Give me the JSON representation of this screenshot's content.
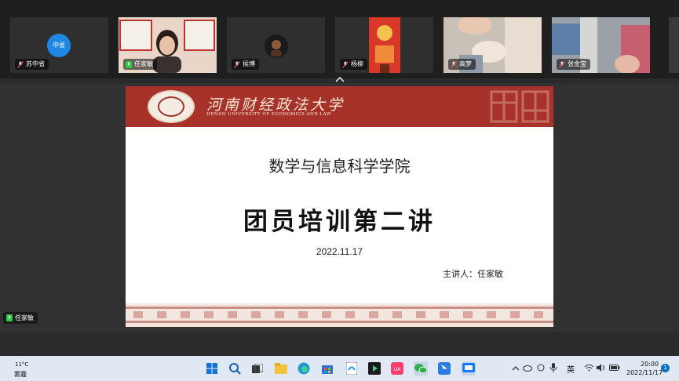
{
  "participants": [
    {
      "name": "苏中省",
      "avatar_text": "中省",
      "mic": "muted"
    },
    {
      "name": "任家敏",
      "mic": "active"
    },
    {
      "name": "侯博",
      "mic": "muted"
    },
    {
      "name": "杨柳",
      "mic": "muted"
    },
    {
      "name": "高梦",
      "mic": "muted"
    },
    {
      "name": "张金宝",
      "mic": "muted"
    }
  ],
  "slide": {
    "university_cn": "河南财经政法大学",
    "university_en": "HENAN UNIVERSITY OF ECONOMICS AND LAW",
    "college": "数学与信息科学学院",
    "lecture_title": "团员培训第二讲",
    "date": "2022.11.17",
    "speaker": "主讲人：任家敏"
  },
  "self_view": {
    "name": "任家敏"
  },
  "taskbar": {
    "weather": {
      "temp": "11°C",
      "desc": "雾霾"
    },
    "icons": [
      "windows-start-icon",
      "search-icon",
      "task-view-icon",
      "file-explorer-icon",
      "edge-browser-icon",
      "store-icon",
      "notepad-icon",
      "media-player-icon",
      "game-app-icon",
      "wechat-icon",
      "feishu-icon",
      "meeting-app-icon"
    ],
    "ime": "英",
    "time": "20:00",
    "date": "2022/11/17",
    "notification_count": "1"
  },
  "colors": {
    "brand_red": "#a6322a",
    "taskbar_bg": "#dfe8f3",
    "avatar_blue": "#1e88e5"
  }
}
